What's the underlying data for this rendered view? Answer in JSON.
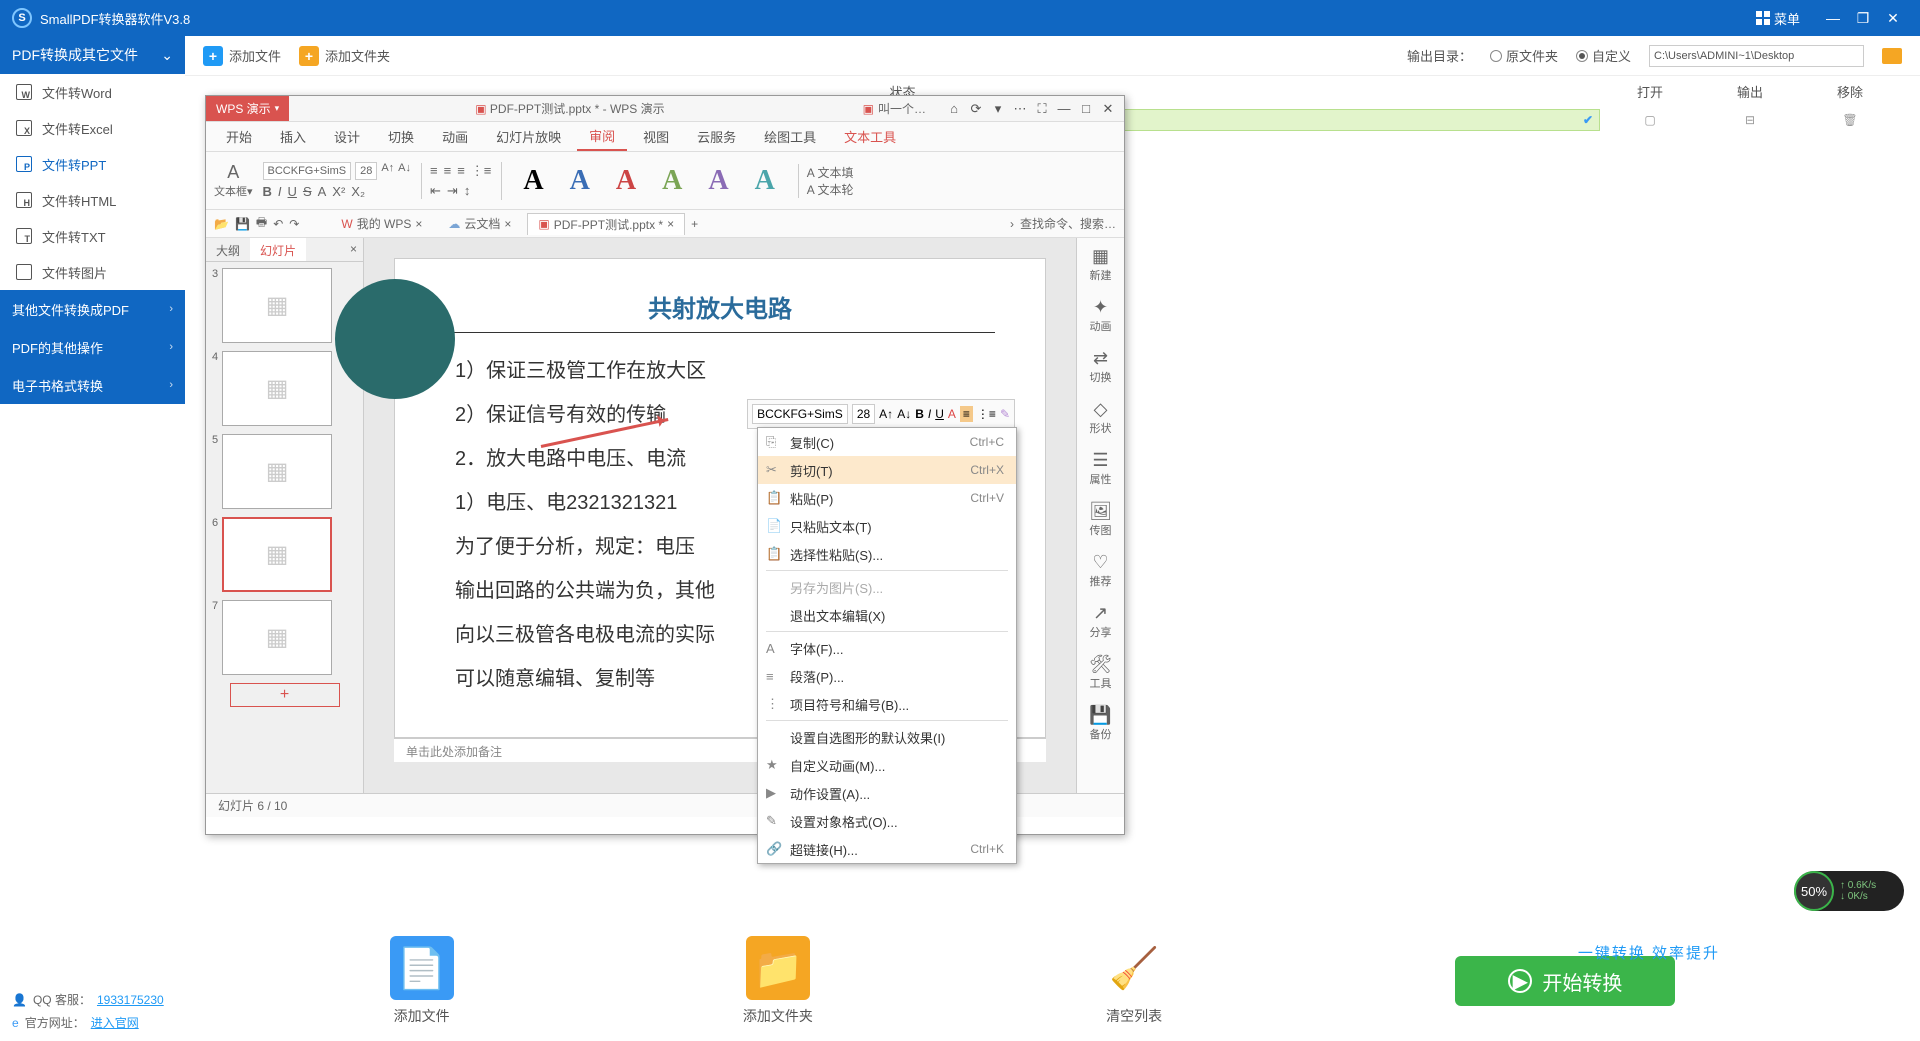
{
  "titlebar": {
    "title": "SmallPDF转换器软件V3.8",
    "menu": "菜单"
  },
  "sidebar": {
    "section1": "PDF转换成其它文件",
    "items": [
      {
        "label": "文件转Word",
        "letter": "W"
      },
      {
        "label": "文件转Excel",
        "letter": "X"
      },
      {
        "label": "文件转PPT",
        "letter": "P"
      },
      {
        "label": "文件转HTML",
        "letter": "H"
      },
      {
        "label": "文件转TXT",
        "letter": "T"
      },
      {
        "label": "文件转图片",
        "letter": ""
      }
    ],
    "section2": "其他文件转换成PDF",
    "section3": "PDF的其他操作",
    "section4": "电子书格式转换"
  },
  "toolbar": {
    "addFile": "添加文件",
    "addFolder": "添加文件夹",
    "outputDir": "输出目录：",
    "srcFolder": "原文件夹",
    "custom": "自定义",
    "path": "C:\\Users\\ADMINI~1\\Desktop"
  },
  "table": {
    "status": "状态",
    "open": "打开",
    "output": "输出",
    "remove": "移除",
    "row": {
      "progress": "100%"
    }
  },
  "wps": {
    "badge": "WPS 演示",
    "docName": "PDF-PPT测试.pptx * - WPS 演示",
    "tab2": "叫一个…",
    "menu": [
      "开始",
      "插入",
      "设计",
      "切换",
      "动画",
      "幻灯片放映",
      "审阅",
      "视图",
      "云服务",
      "绘图工具",
      "文本工具"
    ],
    "font": "BCCKFG+SimS",
    "fontSize": "28",
    "sideLabels": [
      "文本填",
      "文本轮"
    ],
    "docTabs": {
      "my": "我的 WPS",
      "cloud": "云文档",
      "file": "PDF-PPT测试.pptx *"
    },
    "search": "查找命令、搜索…",
    "slidePanel": {
      "outline": "大纲",
      "slides": "幻灯片"
    },
    "thumbs": [
      "3",
      "4",
      "5",
      "6",
      "7"
    ],
    "rpanel": [
      "新建",
      "动画",
      "切换",
      "形状",
      "属性",
      "传图",
      "推荐",
      "分享",
      "工具",
      "备份"
    ],
    "notes": "单击此处添加备注",
    "status": "幻灯片 6 / 10",
    "slide": {
      "title": "共射放大电路",
      "l1": "1）保证三极管工作在放大区",
      "l2": "2）保证信号有效的传输",
      "l3": "2．放大电路中电压、电流",
      "l4": "1）电压、电2321321321",
      "l5": "为了便于分析，规定：电压",
      "l6": "输出回路的公共端为负，其他",
      "l7": "向以三极管各电极电流的实际",
      "note": "可以随意编辑、复制等"
    },
    "floatbar": {
      "font": "BCCKFG+SimS",
      "size": "28"
    },
    "context": [
      {
        "label": "复制(C)",
        "sc": "Ctrl+C",
        "ico": "⎘"
      },
      {
        "label": "剪切(T)",
        "sc": "Ctrl+X",
        "ico": "✂",
        "hover": true
      },
      {
        "label": "粘贴(P)",
        "sc": "Ctrl+V",
        "ico": "📋"
      },
      {
        "label": "只粘贴文本(T)",
        "ico": "📄"
      },
      {
        "label": "选择性粘贴(S)...",
        "ico": "📋"
      },
      {
        "sep": true
      },
      {
        "label": "另存为图片(S)...",
        "disabled": true
      },
      {
        "label": "退出文本编辑(X)"
      },
      {
        "sep": true
      },
      {
        "label": "字体(F)...",
        "ico": "A"
      },
      {
        "label": "段落(P)...",
        "ico": "≡"
      },
      {
        "label": "项目符号和编号(B)...",
        "ico": "⋮"
      },
      {
        "sep": true
      },
      {
        "label": "设置自选图形的默认效果(I)"
      },
      {
        "label": "自定义动画(M)...",
        "ico": "★"
      },
      {
        "label": "动作设置(A)...",
        "ico": "▶"
      },
      {
        "label": "设置对象格式(O)...",
        "ico": "✎"
      },
      {
        "label": "超链接(H)...",
        "sc": "Ctrl+K",
        "ico": "🔗"
      }
    ]
  },
  "bottom": {
    "addFile": "添加文件",
    "addFolder": "添加文件夹",
    "clear": "清空列表",
    "promo": "一键转换 效率提升",
    "start": "开始转换"
  },
  "footer": {
    "qq": "QQ 客服：",
    "qqNum": "1933175230",
    "site": "官方网址：",
    "siteUrl": "进入官网"
  },
  "speed": {
    "pct": "50%",
    "up": "0.6K/s",
    "down": "0K/s"
  }
}
